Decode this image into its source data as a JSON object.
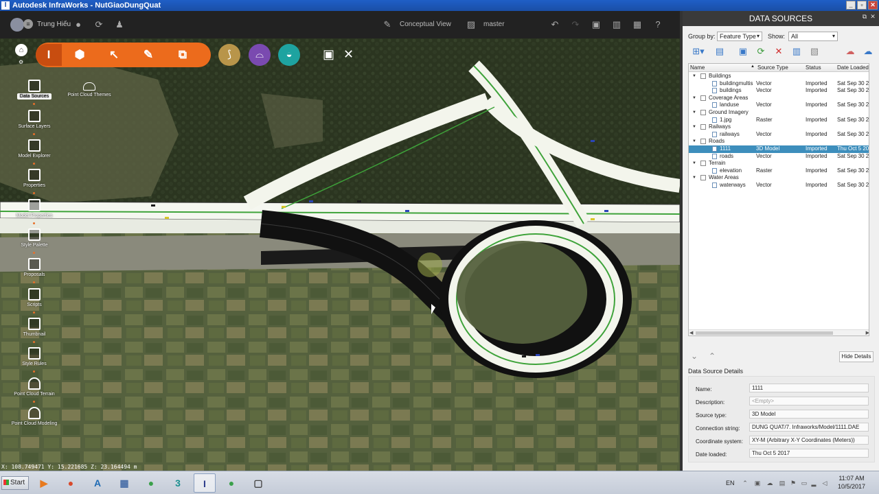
{
  "window": {
    "title": "Autodesk InfraWorks - NutGiaoDungQuat",
    "app_icon": "I"
  },
  "toolbar": {
    "user": "Trung Hiếu",
    "view_mode": "Conceptual View",
    "branch": "master"
  },
  "left_panel": {
    "items": [
      {
        "label": "Data Sources",
        "icon": "database-icon",
        "active": true
      },
      {
        "label": "Surface Layers",
        "icon": "layers-icon"
      },
      {
        "label": "Model Explorer",
        "icon": "model-explorer-icon"
      },
      {
        "label": "Properties",
        "icon": "properties-icon"
      },
      {
        "label": "Model Properties",
        "icon": "model-properties-icon"
      },
      {
        "label": "Style Palette",
        "icon": "palette-icon"
      },
      {
        "label": "Proposals",
        "icon": "proposals-icon"
      },
      {
        "label": "Scripts",
        "icon": "scripts-icon"
      },
      {
        "label": "Thumbnail",
        "icon": "thumbnail-icon"
      },
      {
        "label": "Style Rules",
        "icon": "style-rules-icon"
      },
      {
        "label": "Point Cloud Terrain",
        "icon": "point-cloud-terrain-icon"
      },
      {
        "label": "Point Cloud Modeling",
        "icon": "point-cloud-modeling-icon"
      }
    ],
    "secondary": {
      "label": "Point Cloud Themes",
      "icon": "point-cloud-themes-icon"
    }
  },
  "status": {
    "coords": "X: 108.749471 Y: 15.221685 Z: 23.164494 m"
  },
  "panel": {
    "title": "DATA SOURCES",
    "group_by_label": "Group by:",
    "group_by_value": "Feature Type",
    "show_label": "Show:",
    "show_value": "All",
    "columns": [
      "Name",
      "Source Type",
      "Status",
      "Date Loaded"
    ],
    "rows": [
      {
        "level": 0,
        "name": "Buildings"
      },
      {
        "level": 1,
        "name": "buildingmultis",
        "type": "Vector",
        "status": "Imported",
        "date": "Sat Sep 30 20"
      },
      {
        "level": 1,
        "name": "buildings",
        "type": "Vector",
        "status": "Imported",
        "date": "Sat Sep 30 20"
      },
      {
        "level": 0,
        "name": "Coverage Areas"
      },
      {
        "level": 1,
        "name": "landuse",
        "type": "Vector",
        "status": "Imported",
        "date": "Sat Sep 30 20"
      },
      {
        "level": 0,
        "name": "Ground Imagery"
      },
      {
        "level": 1,
        "name": "1.jpg",
        "type": "Raster",
        "status": "Imported",
        "date": "Sat Sep 30 20"
      },
      {
        "level": 0,
        "name": "Railways"
      },
      {
        "level": 1,
        "name": "railways",
        "type": "Vector",
        "status": "Imported",
        "date": "Sat Sep 30 20"
      },
      {
        "level": 0,
        "name": "Roads"
      },
      {
        "level": 1,
        "name": "1111",
        "type": "3D Model",
        "status": "Imported",
        "date": "Thu Oct 5 201",
        "selected": true
      },
      {
        "level": 1,
        "name": "roads",
        "type": "Vector",
        "status": "Imported",
        "date": "Sat Sep 30 20"
      },
      {
        "level": 0,
        "name": "Terrain"
      },
      {
        "level": 1,
        "name": "elevation",
        "type": "Raster",
        "status": "Imported",
        "date": "Sat Sep 30 20"
      },
      {
        "level": 0,
        "name": "Water Areas"
      },
      {
        "level": 1,
        "name": "waterways",
        "type": "Vector",
        "status": "Imported",
        "date": "Sat Sep 30 20"
      }
    ],
    "hide_details": "Hide Details",
    "details_title": "Data Source Details",
    "details": [
      {
        "label": "Name:",
        "value": "1111"
      },
      {
        "label": "Description:",
        "value": "<Empty>",
        "empty": true
      },
      {
        "label": "Source type:",
        "value": "3D Model"
      },
      {
        "label": "Connection string:",
        "value": "DUNG QUAT/7. Infraworks/Model/1111.DAE"
      },
      {
        "label": "Coordinate system:",
        "value": "XY-M (Arbitrary X-Y Coordinates (Meters))"
      },
      {
        "label": "Date loaded:",
        "value": "Thu Oct 5 2017"
      }
    ]
  },
  "taskbar": {
    "start": "Start",
    "apps": [
      {
        "icon": "media-player-icon",
        "glyph": "▶",
        "color": "#e87a1e"
      },
      {
        "icon": "chrome-icon",
        "glyph": "●",
        "color": "#d84a2c"
      },
      {
        "icon": "autocad-icon",
        "glyph": "A",
        "color": "#1f6bb4"
      },
      {
        "icon": "calculator-icon",
        "glyph": "▦",
        "color": "#4a6fa8"
      },
      {
        "icon": "chrome-icon-2",
        "glyph": "●",
        "color": "#3aa04a"
      },
      {
        "icon": "3dsmax-icon",
        "glyph": "3",
        "color": "#1a8f8f"
      },
      {
        "icon": "infraworks-icon",
        "glyph": "I",
        "color": "#2a3a8a",
        "active": true
      },
      {
        "icon": "chrome-icon-3",
        "glyph": "●",
        "color": "#3aa04a"
      },
      {
        "icon": "window-icon",
        "glyph": "▢",
        "color": "#444"
      }
    ],
    "lang": "EN",
    "time": "11:07 AM",
    "date": "10/5/2017"
  }
}
